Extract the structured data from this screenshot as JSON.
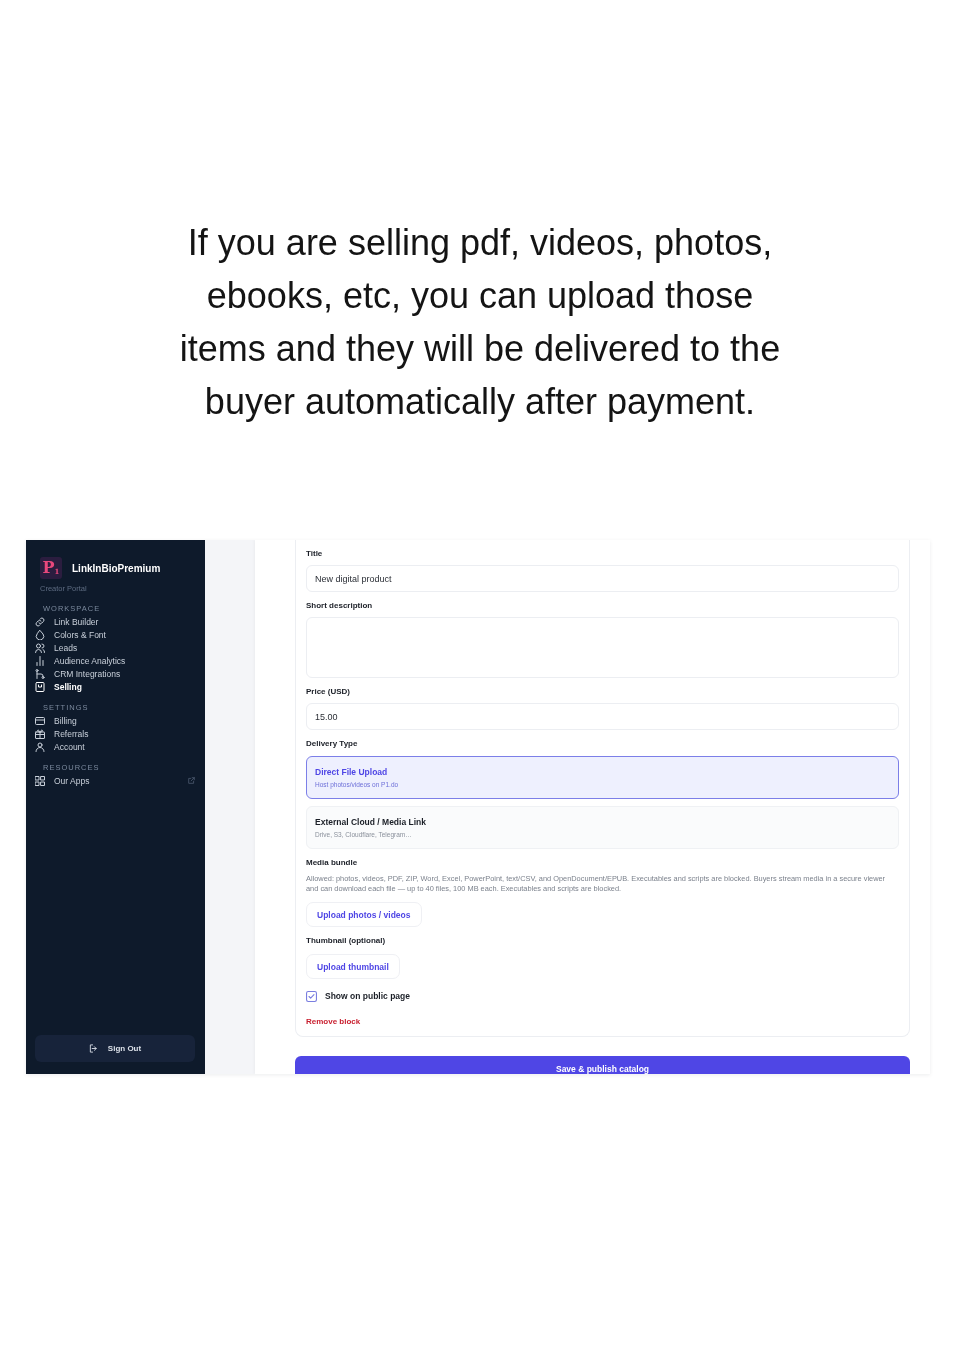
{
  "caption": "If you are selling pdf, videos, photos, ebooks, etc, you can upload those items and they will be delivered to the buyer automatically after payment.",
  "sidebar": {
    "logo": "P$_{1}$",
    "brand": "LinkInBioPremium",
    "subtitle": "Creator Portal",
    "sections": [
      {
        "heading": "WORKSPACE",
        "items": [
          {
            "label": "Link Builder",
            "selected": false
          },
          {
            "label": "Colors & Font",
            "selected": false
          },
          {
            "label": "Leads",
            "selected": false
          },
          {
            "label": "Audience Analytics",
            "selected": false
          },
          {
            "label": "CRM Integrations",
            "selected": false
          },
          {
            "label": "Selling",
            "selected": true
          }
        ]
      },
      {
        "heading": "SETTINGS",
        "items": [
          {
            "label": "Billing",
            "selected": false
          },
          {
            "label": "Referrals",
            "selected": false
          },
          {
            "label": "Account",
            "selected": false
          }
        ]
      },
      {
        "heading": "RESOURCES",
        "items": [
          {
            "label": "Our Apps",
            "selected": false
          }
        ]
      }
    ],
    "sign_out": "Sign Out"
  },
  "form": {
    "fields": [
      {
        "kind": "text",
        "label": "Title",
        "value": "New digital product"
      },
      {
        "kind": "textarea",
        "label": "Short description"
      },
      {
        "kind": "text",
        "label": "Price (USD)",
        "value": "15.00"
      }
    ],
    "delivery_type": {
      "label": "Delivery Type",
      "options": [
        {
          "title": "Direct File Upload",
          "subtitle": "Host photos/videos on P1.do",
          "selected": true
        },
        {
          "title": "External Cloud / Media Link",
          "subtitle": "Drive, S3, Cloudflare, Telegram…",
          "selected": false
        }
      ]
    },
    "media_bundle": {
      "label": "Media bundle",
      "note": "Allowed: photos, videos, PDF, ZIP, Word, Excel, PowerPoint, text/CSV, and OpenDocument/EPUB. Executables and scripts are blocked. Buyers stream media in a secure viewer and can download each file — up to 40 files, 100 MB each. Executables and scripts are blocked.",
      "button": "Upload photos / videos"
    },
    "thumbnail": {
      "label": "Thumbnail (optional)",
      "button": "Upload thumbnail"
    },
    "show_on_public_page": {
      "label": "Show on public page",
      "checked": true
    },
    "remove_block": "Remove block",
    "save_button": "Save & publish catalog"
  }
}
